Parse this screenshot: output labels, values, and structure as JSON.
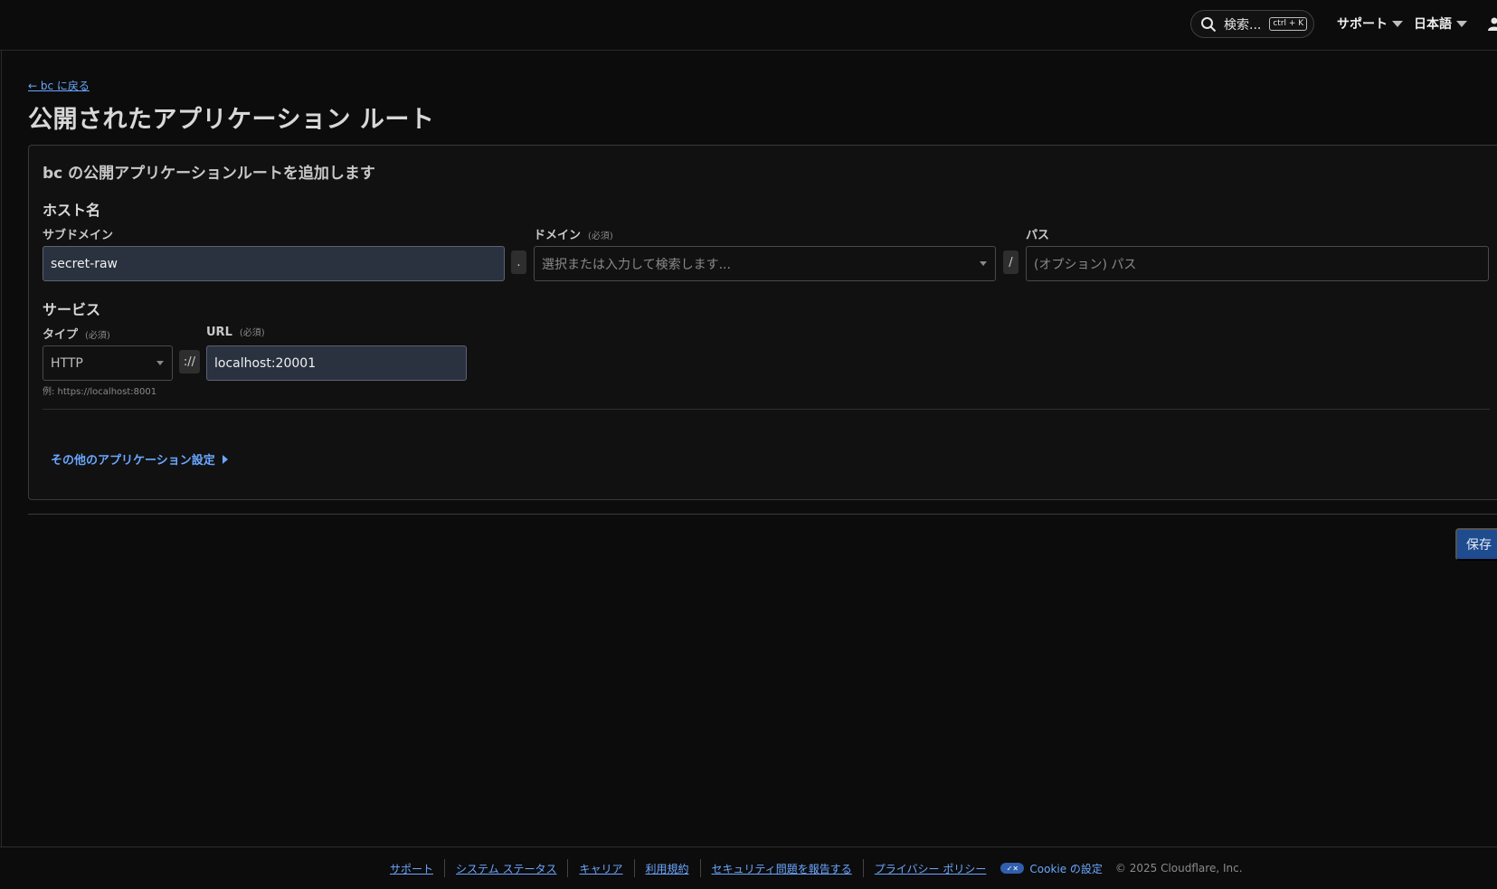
{
  "topbar": {
    "search_label": "検索...",
    "search_shortcut": "ctrl + K",
    "support_label": "サポート",
    "language_label": "日本語"
  },
  "breadcrumb": {
    "back_link": "← bc に戻る"
  },
  "page": {
    "title": "公開されたアプリケーション ルート",
    "card_title": "bc の公開アプリケーションルートを追加します"
  },
  "hostname": {
    "section_title": "ホスト名",
    "subdomain_label": "サブドメイン",
    "subdomain_value": "secret-raw",
    "dot_separator": ".",
    "domain_label": "ドメイン",
    "domain_required": "(必須)",
    "domain_placeholder": "選択または入力して検索します...",
    "slash_separator": "/",
    "path_label": "パス",
    "path_placeholder": "(オプション) パス"
  },
  "service": {
    "section_title": "サービス",
    "type_label": "タイプ",
    "type_required": "(必須)",
    "type_value": "HTTP",
    "scheme_separator": "://",
    "url_label": "URL",
    "url_required": "(必須)",
    "url_value": "localhost:20001",
    "example_text": "例: https://localhost:8001"
  },
  "more_settings_label": "その他のアプリケーション設定",
  "save_button_label": "保存",
  "footer": {
    "links": [
      "サポート",
      "システム ステータス",
      "キャリア",
      "利用規約",
      "セキュリティ問題を報告する",
      "プライバシー ポリシー"
    ],
    "cookie_label": "Cookie の設定",
    "copyright": "© 2025 Cloudflare, Inc."
  },
  "colors": {
    "background": "#0c0c0c",
    "link": "#6aa7ff",
    "primary_button": "#1f4b8f",
    "filled_input": "#2a3240"
  },
  "icons": [
    "search-icon",
    "chevron-down-icon",
    "user-icon",
    "caret-right-icon",
    "cookie-toggle-icon"
  ]
}
